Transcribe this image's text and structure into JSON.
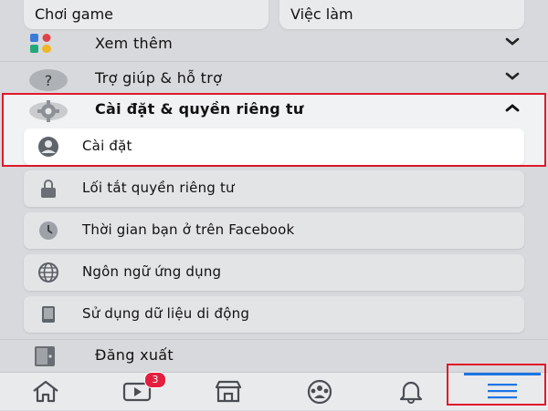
{
  "top_shortcuts": [
    {
      "label": "Chơi game"
    },
    {
      "label": "Việc làm"
    }
  ],
  "sections": [
    {
      "label": "Xem thêm",
      "icon": "shapes-icon",
      "state": "collapsed"
    },
    {
      "label": "Trợ giúp & hỗ trợ",
      "icon": "question-icon",
      "state": "collapsed"
    },
    {
      "label": "Cài đặt & quyền riêng tư",
      "icon": "gear-icon",
      "state": "expanded"
    }
  ],
  "settings_items": [
    {
      "label": "Cài đặt",
      "icon": "profile-circle-icon",
      "active": true
    },
    {
      "label": "Lối tắt quyền riêng tư",
      "icon": "lock-icon",
      "active": false
    },
    {
      "label": "Thời gian bạn ở trên Facebook",
      "icon": "clock-icon",
      "active": false
    },
    {
      "label": "Ngôn ngữ ứng dụng",
      "icon": "globe-icon",
      "active": false
    },
    {
      "label": "Sử dụng dữ liệu di động",
      "icon": "phone-icon",
      "active": false
    }
  ],
  "logout": {
    "label": "Đăng xuất",
    "icon": "door-icon"
  },
  "bottom_nav": {
    "items": [
      {
        "name": "home"
      },
      {
        "name": "watch",
        "badge": "3"
      },
      {
        "name": "marketplace"
      },
      {
        "name": "groups"
      },
      {
        "name": "notifications"
      },
      {
        "name": "menu",
        "active": true
      }
    ]
  },
  "colors": {
    "highlight_border": "#e0192a",
    "badge": "#e41e3f",
    "active_nav": "#1b74e4",
    "background": "#d8d9dc"
  }
}
